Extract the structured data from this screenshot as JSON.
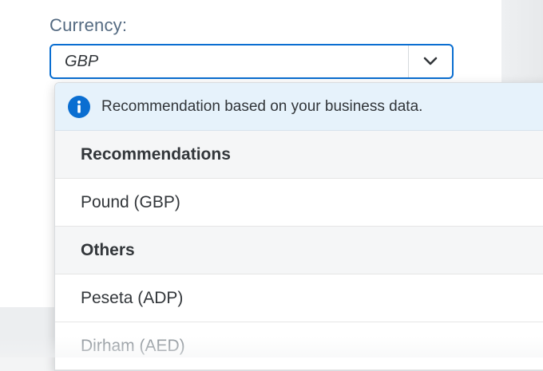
{
  "field": {
    "label": "Currency:",
    "value": "GBP",
    "dropdown_icon": "chevron-down-icon"
  },
  "popover": {
    "info": {
      "icon": "info-icon",
      "text": "Recommendation based on your business data."
    },
    "groups": [
      {
        "header": "Recommendations",
        "items": [
          "Pound (GBP)"
        ]
      },
      {
        "header": "Others",
        "items": [
          "Peseta (ADP)",
          "Dirham (AED)"
        ]
      }
    ]
  },
  "colors": {
    "accent": "#0a6ed1",
    "info_background": "#e6f2fb",
    "group_background": "#f5f6f7",
    "label_text": "#556b82"
  }
}
